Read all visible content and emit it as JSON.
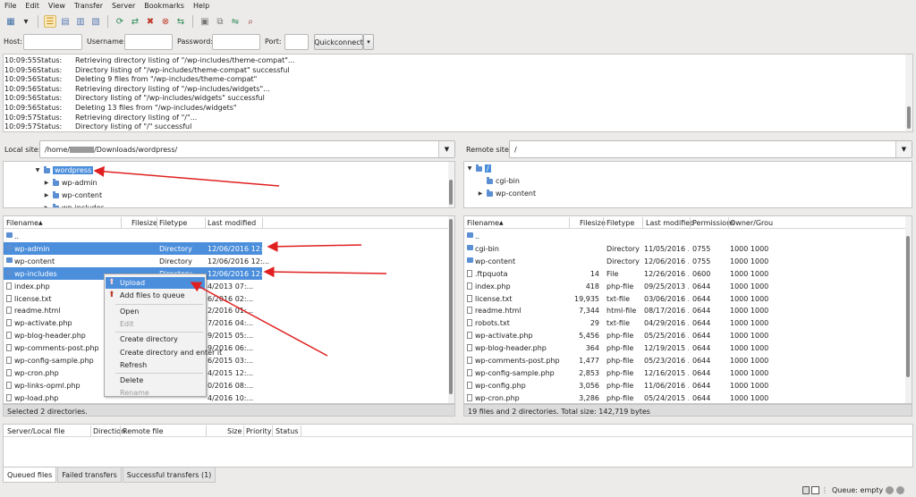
{
  "menu": [
    "File",
    "Edit",
    "View",
    "Transfer",
    "Server",
    "Bookmarks",
    "Help"
  ],
  "toolbar_icons": [
    "site-manager-icon",
    "dropdown-arrow-icon",
    "toggle-log-icon",
    "toggle-local-tree-icon",
    "toggle-remote-tree-icon",
    "toggle-queue-icon",
    "refresh-icon",
    "process-queue-icon",
    "cancel-icon",
    "disconnect-icon",
    "reconnect-icon",
    "filter-icon",
    "compare-icon",
    "sync-browse-icon",
    "find-icon"
  ],
  "quickconnect": {
    "host_label": "Host:",
    "user_label": "Username:",
    "pass_label": "Password:",
    "port_label": "Port:",
    "host_value": "",
    "user_value": "",
    "pass_value": "",
    "port_value": "",
    "button": "Quickconnect",
    "dropdown": "▾"
  },
  "log": [
    {
      "time": "10:09:55",
      "type": "Status:",
      "msg": "Retrieving directory listing of \"/wp-includes/theme-compat\"..."
    },
    {
      "time": "10:09:56",
      "type": "Status:",
      "msg": "Directory listing of \"/wp-includes/theme-compat\" successful"
    },
    {
      "time": "10:09:56",
      "type": "Status:",
      "msg": "Deleting 9 files from \"/wp-includes/theme-compat\""
    },
    {
      "time": "10:09:56",
      "type": "Status:",
      "msg": "Retrieving directory listing of \"/wp-includes/widgets\"..."
    },
    {
      "time": "10:09:56",
      "type": "Status:",
      "msg": "Directory listing of \"/wp-includes/widgets\" successful"
    },
    {
      "time": "10:09:56",
      "type": "Status:",
      "msg": "Deleting 13 files from \"/wp-includes/widgets\""
    },
    {
      "time": "10:09:57",
      "type": "Status:",
      "msg": "Retrieving directory listing of \"/\"..."
    },
    {
      "time": "10:09:57",
      "type": "Status:",
      "msg": "Directory listing of \"/\" successful"
    }
  ],
  "local": {
    "site_label": "Local site:",
    "path_prefix": "/home/",
    "path_suffix": "/Downloads/wordpress/",
    "tree": [
      {
        "label": "wordpress",
        "expanded": true,
        "selected": true
      },
      {
        "label": "wp-admin",
        "expanded": false
      },
      {
        "label": "wp-content",
        "expanded": false
      },
      {
        "label": "wp-includes",
        "expanded": false
      }
    ],
    "columns": [
      "Filename",
      "Filesize",
      "Filetype",
      "Last modified"
    ],
    "sort_indicator": "▲",
    "files": [
      {
        "name": "..",
        "size": "",
        "type": "",
        "date": "",
        "folder": true,
        "sel": false
      },
      {
        "name": "wp-admin",
        "size": "",
        "type": "Directory",
        "date": "12/06/2016 12:...",
        "folder": true,
        "sel": true
      },
      {
        "name": "wp-content",
        "size": "",
        "type": "Directory",
        "date": "12/06/2016 12:...",
        "folder": true,
        "sel": false
      },
      {
        "name": "wp-includes",
        "size": "",
        "type": "Directory",
        "date": "12/06/2016 12:...",
        "folder": true,
        "sel": true
      },
      {
        "name": "index.php",
        "size": "",
        "type": "",
        "date": "4/2013 07:...",
        "folder": false,
        "sel": false
      },
      {
        "name": "license.txt",
        "size": "",
        "type": "",
        "date": "6/2016 02:...",
        "folder": false,
        "sel": false
      },
      {
        "name": "readme.html",
        "size": "",
        "type": "",
        "date": "2/2016 01:...",
        "folder": false,
        "sel": false
      },
      {
        "name": "wp-activate.php",
        "size": "",
        "type": "",
        "date": "7/2016 04:...",
        "folder": false,
        "sel": false
      },
      {
        "name": "wp-blog-header.php",
        "size": "",
        "type": "",
        "date": "9/2015 05:...",
        "folder": false,
        "sel": false
      },
      {
        "name": "wp-comments-post.php",
        "size": "",
        "type": "",
        "date": "9/2016 06:...",
        "folder": false,
        "sel": false
      },
      {
        "name": "wp-config-sample.php",
        "size": "",
        "type": "",
        "date": "6/2015 03:...",
        "folder": false,
        "sel": false
      },
      {
        "name": "wp-cron.php",
        "size": "",
        "type": "",
        "date": "4/2015 12:...",
        "folder": false,
        "sel": false
      },
      {
        "name": "wp-links-opml.php",
        "size": "",
        "type": "",
        "date": "0/2016 08:...",
        "folder": false,
        "sel": false
      },
      {
        "name": "wp-load.php",
        "size": "",
        "type": "",
        "date": "4/2016 10:...",
        "folder": false,
        "sel": false
      }
    ],
    "status": "Selected 2 directories."
  },
  "remote": {
    "site_label": "Remote site:",
    "path": "/",
    "tree": [
      {
        "label": "/",
        "expanded": true,
        "selected": true
      },
      {
        "label": "cgi-bin",
        "expanded": false
      },
      {
        "label": "wp-content",
        "expanded": false
      }
    ],
    "columns": [
      "Filename",
      "Filesize",
      "Filetype",
      "Last modified",
      "Permissions",
      "Owner/Grou"
    ],
    "sort_indicator": "▲",
    "files": [
      {
        "name": "..",
        "size": "",
        "type": "",
        "date": "",
        "perm": "",
        "owner": "",
        "folder": true
      },
      {
        "name": "cgi-bin",
        "size": "",
        "type": "Directory",
        "date": "11/05/2016 ...",
        "perm": "0755",
        "owner": "1000 1000",
        "folder": true
      },
      {
        "name": "wp-content",
        "size": "",
        "type": "Directory",
        "date": "12/06/2016 ...",
        "perm": "0755",
        "owner": "1000 1000",
        "folder": true
      },
      {
        "name": ".ftpquota",
        "size": "14",
        "type": "File",
        "date": "12/26/2016 ...",
        "perm": "0600",
        "owner": "1000 1000",
        "folder": false
      },
      {
        "name": "index.php",
        "size": "418",
        "type": "php-file",
        "date": "09/25/2013 ...",
        "perm": "0644",
        "owner": "1000 1000",
        "folder": false
      },
      {
        "name": "license.txt",
        "size": "19,935",
        "type": "txt-file",
        "date": "03/06/2016 ...",
        "perm": "0644",
        "owner": "1000 1000",
        "folder": false
      },
      {
        "name": "readme.html",
        "size": "7,344",
        "type": "html-file",
        "date": "08/17/2016 ...",
        "perm": "0644",
        "owner": "1000 1000",
        "folder": false
      },
      {
        "name": "robots.txt",
        "size": "29",
        "type": "txt-file",
        "date": "04/29/2016 ...",
        "perm": "0644",
        "owner": "1000 1000",
        "folder": false
      },
      {
        "name": "wp-activate.php",
        "size": "5,456",
        "type": "php-file",
        "date": "05/25/2016 ...",
        "perm": "0644",
        "owner": "1000 1000",
        "folder": false
      },
      {
        "name": "wp-blog-header.php",
        "size": "364",
        "type": "php-file",
        "date": "12/19/2015 ...",
        "perm": "0644",
        "owner": "1000 1000",
        "folder": false
      },
      {
        "name": "wp-comments-post.php",
        "size": "1,477",
        "type": "php-file",
        "date": "05/23/2016 ...",
        "perm": "0644",
        "owner": "1000 1000",
        "folder": false
      },
      {
        "name": "wp-config-sample.php",
        "size": "2,853",
        "type": "php-file",
        "date": "12/16/2015 ...",
        "perm": "0644",
        "owner": "1000 1000",
        "folder": false
      },
      {
        "name": "wp-config.php",
        "size": "3,056",
        "type": "php-file",
        "date": "11/06/2016 ...",
        "perm": "0644",
        "owner": "1000 1000",
        "folder": false
      },
      {
        "name": "wp-cron.php",
        "size": "3,286",
        "type": "php-file",
        "date": "05/24/2015 ...",
        "perm": "0644",
        "owner": "1000 1000",
        "folder": false
      }
    ],
    "status": "19 files and 2 directories. Total size: 142,719 bytes"
  },
  "context_menu": [
    {
      "label": "Upload",
      "state": "hl",
      "icon": "upload-icon"
    },
    {
      "label": "Add files to queue",
      "state": "",
      "icon": "add-queue-icon"
    },
    {
      "label": "sep"
    },
    {
      "label": "Open",
      "state": ""
    },
    {
      "label": "Edit",
      "state": "dis"
    },
    {
      "label": "sep"
    },
    {
      "label": "Create directory",
      "state": ""
    },
    {
      "label": "Create directory and enter it",
      "state": ""
    },
    {
      "label": "Refresh",
      "state": ""
    },
    {
      "label": "sep"
    },
    {
      "label": "Delete",
      "state": ""
    },
    {
      "label": "Rename",
      "state": "dis"
    }
  ],
  "queue": {
    "columns": [
      "Server/Local file",
      "Direction",
      "Remote file",
      "Size",
      "Priority",
      "Status"
    ],
    "tabs": [
      "Queued files",
      "Failed transfers",
      "Successful transfers (1)"
    ],
    "active_tab": 0
  },
  "bottom": {
    "queue_status": "Queue: empty"
  },
  "colors": {
    "selection": "#4b8edb",
    "annotation_arrow": "#e02020",
    "folder": "#5b8fd3"
  }
}
